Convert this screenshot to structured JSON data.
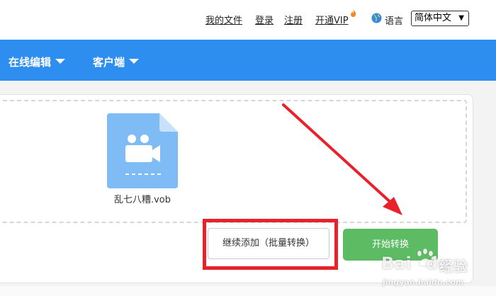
{
  "header": {
    "links": [
      {
        "label": "我的文件"
      },
      {
        "label": "登录"
      },
      {
        "label": "注册"
      },
      {
        "label": "开通VIP"
      }
    ],
    "language_label": "语言",
    "language_select": {
      "value": "简体中文"
    }
  },
  "nav": {
    "items": [
      {
        "label": "在线编辑"
      },
      {
        "label": "客户端"
      }
    ]
  },
  "upload": {
    "file_name": "乱七八糟.vob",
    "add_button": "继续添加（批量转换）",
    "start_button": "开始转换"
  },
  "watermark": {
    "brand": "Bai",
    "brand_suffix": "du",
    "jingyan": "经验",
    "url": "jingyan.baidu.com"
  },
  "colors": {
    "nav_bg": "#2e8ef0",
    "start_button": "#5dbb63",
    "annotation_red": "#e8212a",
    "file_icon": "#7fbcf5"
  }
}
